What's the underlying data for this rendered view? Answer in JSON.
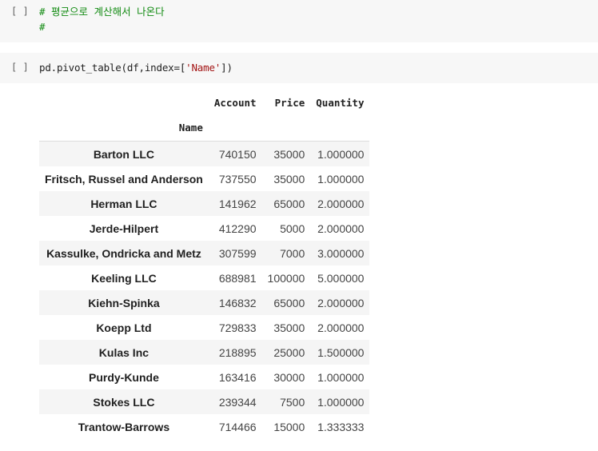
{
  "cells": [
    {
      "run_label": "[ ]",
      "lines": [
        "# 평균으로 계산해서 나온다",
        "#"
      ]
    },
    {
      "run_label": "[ ]",
      "code_prefix": "pd.pivot_table(df,index=[",
      "code_string": "'Name'",
      "code_suffix": "])"
    }
  ],
  "output": {
    "columns": [
      "Account",
      "Price",
      "Quantity"
    ],
    "index_name": "Name",
    "rows": [
      {
        "name": "Barton LLC",
        "account": "740150",
        "price": "35000",
        "quantity": "1.000000"
      },
      {
        "name": "Fritsch, Russel and Anderson",
        "account": "737550",
        "price": "35000",
        "quantity": "1.000000"
      },
      {
        "name": "Herman LLC",
        "account": "141962",
        "price": "65000",
        "quantity": "2.000000"
      },
      {
        "name": "Jerde-Hilpert",
        "account": "412290",
        "price": "5000",
        "quantity": "2.000000"
      },
      {
        "name": "Kassulke, Ondricka and Metz",
        "account": "307599",
        "price": "7000",
        "quantity": "3.000000"
      },
      {
        "name": "Keeling LLC",
        "account": "688981",
        "price": "100000",
        "quantity": "5.000000"
      },
      {
        "name": "Kiehn-Spinka",
        "account": "146832",
        "price": "65000",
        "quantity": "2.000000"
      },
      {
        "name": "Koepp Ltd",
        "account": "729833",
        "price": "35000",
        "quantity": "2.000000"
      },
      {
        "name": "Kulas Inc",
        "account": "218895",
        "price": "25000",
        "quantity": "1.500000"
      },
      {
        "name": "Purdy-Kunde",
        "account": "163416",
        "price": "30000",
        "quantity": "1.000000"
      },
      {
        "name": "Stokes LLC",
        "account": "239344",
        "price": "7500",
        "quantity": "1.000000"
      },
      {
        "name": "Trantow-Barrows",
        "account": "714466",
        "price": "15000",
        "quantity": "1.333333"
      }
    ]
  }
}
